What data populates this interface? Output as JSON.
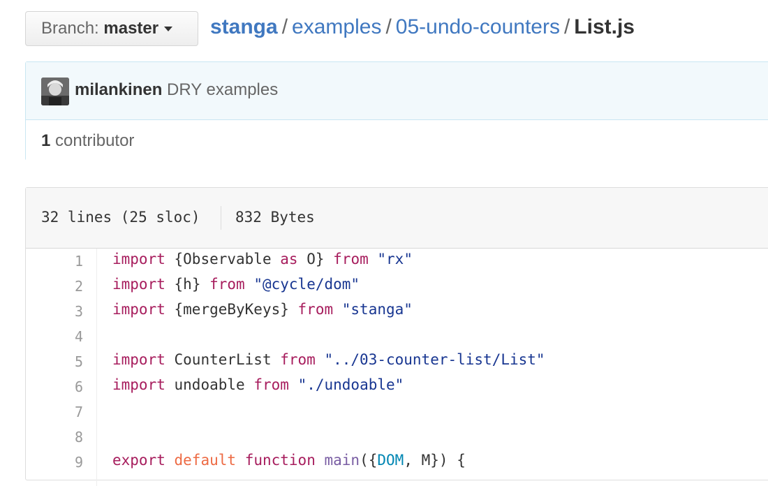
{
  "branch": {
    "prefix": "Branch:",
    "name": "master"
  },
  "breadcrumb": {
    "repo": "stanga",
    "sep": "/",
    "path": [
      "examples",
      "05-undo-counters"
    ],
    "file": "List.js"
  },
  "commit": {
    "author": "milankinen",
    "message": "DRY examples"
  },
  "contributors": {
    "count": "1",
    "label": "contributor"
  },
  "file_info": {
    "lines": "32 lines (25 sloc)",
    "size": "832 Bytes"
  },
  "code": {
    "line_numbers": [
      "1",
      "2",
      "3",
      "4",
      "5",
      "6",
      "7",
      "8",
      "9"
    ],
    "lines": [
      "import {Observable as O} from \"rx\"",
      "import {h} from \"@cycle/dom\"",
      "import {mergeByKeys} from \"stanga\"",
      "",
      "import CounterList from \"../03-counter-list/List\"",
      "import undoable from \"./undoable\"",
      "",
      "",
      "export default function main({DOM, M}) {"
    ]
  },
  "colors": {
    "link": "#4078c0",
    "keyword": "#a71d5d",
    "string": "#183691",
    "default_kw": "#ed6a43",
    "function_name": "#795da3",
    "constant": "#0086b3",
    "commit_bg": "#f2f9fc"
  }
}
